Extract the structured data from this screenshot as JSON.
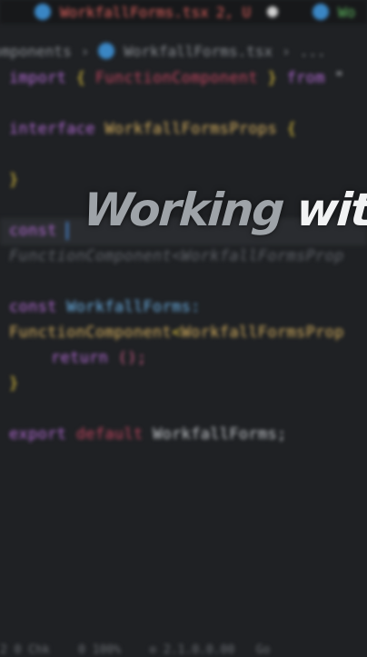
{
  "tabs": [
    {
      "label": "WorkfallForms.tsx",
      "status": "2, U"
    },
    {
      "label": "Wo"
    }
  ],
  "breadcrumb": {
    "part1": "omponents",
    "part2": "WorkfallForms.tsx",
    "more": "..."
  },
  "code": {
    "l1": {
      "kw": "import",
      "open": "{",
      "name": "FunctionComponent",
      "close": "}",
      "from": "from",
      "q": "\""
    },
    "l2": {
      "kw": "interface",
      "name": "WorkfallFormsProps",
      "open": "{"
    },
    "l3": {
      "close": "}"
    },
    "l4": {
      "kw": "const"
    },
    "l5": {
      "text": "FunctionComponent<WorkfallFormsProp"
    },
    "l6": {
      "kw": "const",
      "name": "WorkfallForms:"
    },
    "l7": {
      "type": "FunctionComponent",
      "lt": "<",
      "name": "WorkfallFormsProp"
    },
    "l8": {
      "kw": "return",
      "paren": "();"
    },
    "l9": {
      "close": "}"
    },
    "l10": {
      "kw": "export",
      "kw2": "default",
      "name": "WorkfallForms;"
    }
  },
  "status_bar": {
    "text": "2 0 Chk    0 100%    ⊙ 2.1.0.0.00   Go"
  },
  "overlay": {
    "word1": "Working",
    "word2": "with"
  },
  "colors": {
    "background": "#1f2124",
    "keyword": "#b56bd6",
    "type": "#d8b15e",
    "identifier": "#6cb2e8",
    "error": "#e0625e"
  }
}
